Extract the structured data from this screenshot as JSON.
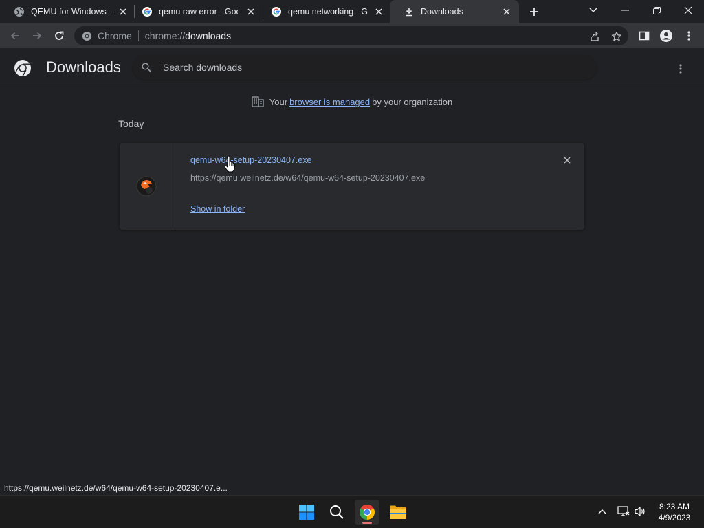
{
  "tabs": [
    {
      "title": "QEMU for Windows – In",
      "favicon": "globe-icon"
    },
    {
      "title": "qemu raw error - Goog",
      "favicon": "google-icon"
    },
    {
      "title": "qemu networking - Go",
      "favicon": "google-icon"
    },
    {
      "title": "Downloads",
      "favicon": "download-icon",
      "active": true
    }
  ],
  "toolbar": {
    "site_chip": "Chrome",
    "url_scheme": "chrome://",
    "url_host": "downloads"
  },
  "page": {
    "title": "Downloads",
    "search_placeholder": "Search downloads",
    "managed_prefix": "Your",
    "managed_link": "browser is managed",
    "managed_suffix": "by your organization",
    "group_label": "Today"
  },
  "download": {
    "file_name": "qemu-w64-setup-20230407.exe",
    "url": "https://qemu.weilnetz.de/w64/qemu-w64-setup-20230407.exe",
    "action": "Show in folder",
    "icon": "qemu-app-icon"
  },
  "status_bar": "https://qemu.weilnetz.de/w64/qemu-w64-setup-20230407.e...",
  "taskbar": {
    "apps": [
      "windows-start-icon",
      "search-icon",
      "chrome-icon",
      "file-explorer-icon"
    ],
    "time": "8:23 AM",
    "date": "4/9/2023"
  },
  "colors": {
    "link": "#8ab4f8",
    "background": "#202124",
    "toolbar": "#35363a",
    "card": "#292a2d"
  }
}
